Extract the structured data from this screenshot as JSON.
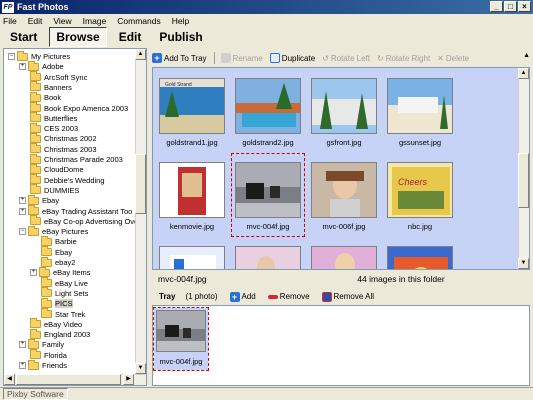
{
  "window": {
    "app_icon_text": "FP",
    "title": "Fast Photos",
    "buttons": [
      "_",
      "□",
      "×"
    ]
  },
  "menu": [
    "File",
    "Edit",
    "View",
    "Image",
    "Commands",
    "Help"
  ],
  "nav_tabs": [
    "Start",
    "Browse",
    "Edit",
    "Publish"
  ],
  "tree": {
    "items": [
      {
        "label": "My Pictures",
        "expander": "−"
      },
      {
        "label": "Adobe",
        "expander": "+"
      },
      {
        "label": "ArcSoft Sync",
        "expander": ""
      },
      {
        "label": "Banners",
        "expander": ""
      },
      {
        "label": "Book",
        "expander": ""
      },
      {
        "label": "Book Expo America 2003",
        "expander": ""
      },
      {
        "label": "Butterflies",
        "expander": ""
      },
      {
        "label": "CES 2003",
        "expander": ""
      },
      {
        "label": "Christmas 2002",
        "expander": ""
      },
      {
        "label": "Christmas 2003",
        "expander": ""
      },
      {
        "label": "Christmas Parade 2003",
        "expander": ""
      },
      {
        "label": "CloudDome",
        "expander": ""
      },
      {
        "label": "Debbie's Wedding",
        "expander": ""
      },
      {
        "label": "DUMMIES",
        "expander": ""
      },
      {
        "label": "Ebay",
        "expander": "+"
      },
      {
        "label": "eBay  Trading Assistant Too",
        "expander": "+"
      },
      {
        "label": "eBay Co-op Advertising Ove",
        "expander": ""
      },
      {
        "label": "eBay Pictures",
        "expander": "−"
      },
      {
        "label": "Barbie",
        "expander": ""
      },
      {
        "label": "Ebay",
        "expander": ""
      },
      {
        "label": "ebay2",
        "expander": ""
      },
      {
        "label": "eBay Items",
        "expander": "+"
      },
      {
        "label": "eBay Live",
        "expander": ""
      },
      {
        "label": "Light Sets",
        "expander": ""
      },
      {
        "label": "PICS",
        "expander": ""
      },
      {
        "label": "Star Trek",
        "expander": ""
      },
      {
        "label": "eBay Video",
        "expander": ""
      },
      {
        "label": "England 2003",
        "expander": ""
      },
      {
        "label": "Family",
        "expander": "+"
      },
      {
        "label": "Florida",
        "expander": ""
      },
      {
        "label": "Friends",
        "expander": "+"
      }
    ]
  },
  "toolbar": {
    "add_to_tray": "Add To Tray",
    "rename": "Rename",
    "duplicate": "Duplicate",
    "rotate_left": "Rotate Left",
    "rotate_right": "Rotate Right",
    "delete": "Delete"
  },
  "thumbnails": [
    {
      "label": "goldstrand1.jpg"
    },
    {
      "label": "goldstrand2.jpg"
    },
    {
      "label": "gsfront.jpg"
    },
    {
      "label": "gssunset.jpg"
    },
    {
      "label": "kenmovie.jpg"
    },
    {
      "label": "mvc-004f.jpg"
    },
    {
      "label": "mvc-006f.jpg"
    },
    {
      "label": "nbc.jpg"
    },
    {
      "label": ""
    },
    {
      "label": ""
    },
    {
      "label": ""
    },
    {
      "label": ""
    }
  ],
  "thumb_overlay_text": "Gold Strand",
  "status": {
    "selected_file": "mvc-004f.jpg",
    "image_count": "44 images in this folder"
  },
  "tray": {
    "title": "Tray",
    "count": "(1 photo)",
    "add": "Add",
    "remove": "Remove",
    "remove_all": "Remove All",
    "items": [
      {
        "label": "mvc-004f.jpg"
      }
    ]
  },
  "footer": "Pixby Software",
  "colors": {
    "title_bar": "#0a246a",
    "grid_background": "#c6d3f7",
    "selection_outline": "#cc0000"
  }
}
